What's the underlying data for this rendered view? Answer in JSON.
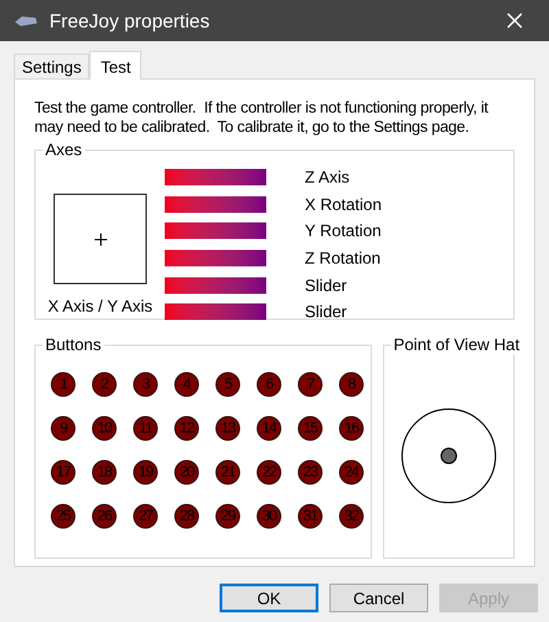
{
  "window": {
    "title": "FreeJoy properties"
  },
  "tabs": [
    {
      "label": "Settings",
      "selected": false
    },
    {
      "label": "Test",
      "selected": true
    }
  ],
  "description": "Test the game controller.  If the controller is not functioning properly, it may need to be calibrated.  To calibrate it, go to the Settings page.",
  "axes": {
    "title": "Axes",
    "xy_label": "X Axis / Y Axis",
    "bars": [
      {
        "name": "Z Axis"
      },
      {
        "name": "X Rotation"
      },
      {
        "name": "Y Rotation"
      },
      {
        "name": "Z Rotation"
      },
      {
        "name": "Slider"
      },
      {
        "name": "Slider"
      }
    ]
  },
  "buttons_group": {
    "title": "Buttons",
    "buttons": [
      {
        "label": "1",
        "pressed": false
      },
      {
        "label": "2",
        "pressed": false
      },
      {
        "label": "3",
        "pressed": false
      },
      {
        "label": "4",
        "pressed": false
      },
      {
        "label": "5",
        "pressed": false
      },
      {
        "label": "6",
        "pressed": false
      },
      {
        "label": "7",
        "pressed": false
      },
      {
        "label": "8",
        "pressed": false
      },
      {
        "label": "9",
        "pressed": false
      },
      {
        "label": "10",
        "pressed": false
      },
      {
        "label": "11",
        "pressed": false
      },
      {
        "label": "12",
        "pressed": false
      },
      {
        "label": "13",
        "pressed": false
      },
      {
        "label": "14",
        "pressed": false
      },
      {
        "label": "15",
        "pressed": false
      },
      {
        "label": "16",
        "pressed": false
      },
      {
        "label": "17",
        "pressed": false
      },
      {
        "label": "18",
        "pressed": false
      },
      {
        "label": "19",
        "pressed": false
      },
      {
        "label": "20",
        "pressed": false
      },
      {
        "label": "21",
        "pressed": false
      },
      {
        "label": "22",
        "pressed": false
      },
      {
        "label": "23",
        "pressed": false
      },
      {
        "label": "24",
        "pressed": false
      },
      {
        "label": "25",
        "pressed": false
      },
      {
        "label": "26",
        "pressed": false
      },
      {
        "label": "27",
        "pressed": false
      },
      {
        "label": "28",
        "pressed": false
      },
      {
        "label": "29",
        "pressed": false
      },
      {
        "label": "30",
        "pressed": false
      },
      {
        "label": "31",
        "pressed": false
      },
      {
        "label": "32",
        "pressed": false
      }
    ]
  },
  "pov": {
    "title": "Point of View Hat"
  },
  "dialog_buttons": [
    {
      "label": "OK",
      "default": true,
      "disabled": false
    },
    {
      "label": "Cancel",
      "default": false,
      "disabled": false
    },
    {
      "label": "Apply",
      "default": false,
      "disabled": true
    }
  ]
}
